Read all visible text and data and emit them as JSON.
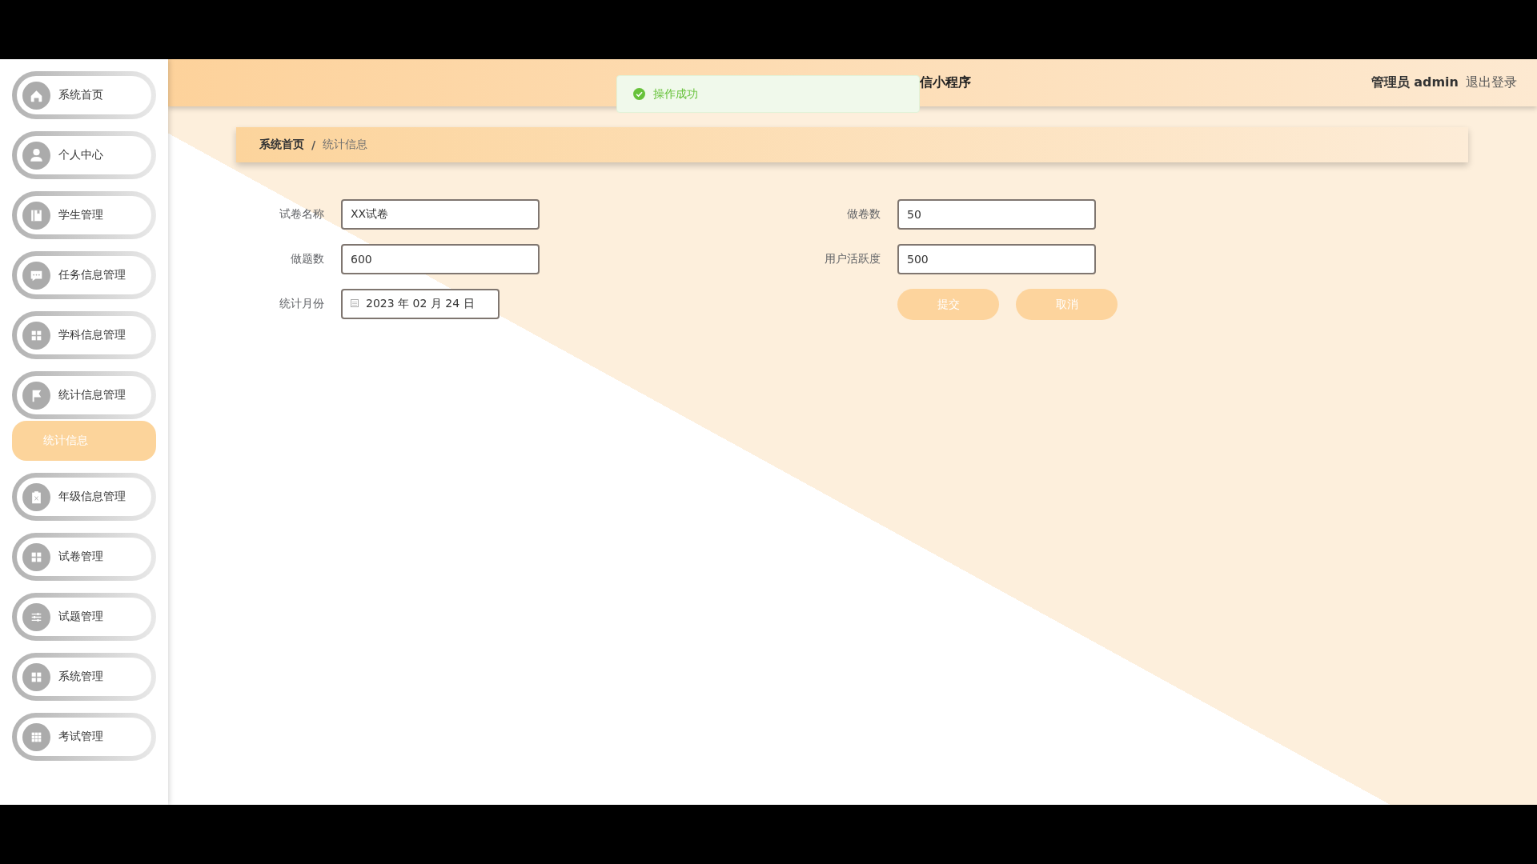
{
  "sidebar": {
    "items": [
      {
        "label": "系统首页"
      },
      {
        "label": "个人中心"
      },
      {
        "label": "学生管理"
      },
      {
        "label": "任务信息管理"
      },
      {
        "label": "学科信息管理"
      },
      {
        "label": "统计信息管理",
        "children": [
          {
            "label": "统计信息",
            "selected": true
          }
        ]
      },
      {
        "label": "年级信息管理"
      },
      {
        "label": "试卷管理"
      },
      {
        "label": "试题管理"
      },
      {
        "label": "系统管理"
      },
      {
        "label": "考试管理"
      }
    ]
  },
  "header": {
    "title": "信小程序",
    "user": "管理员 admin",
    "logout": "退出登录"
  },
  "toast": {
    "kind": "success",
    "message": "操作成功"
  },
  "breadcrumb": {
    "items": [
      "系统首页",
      "统计信息"
    ],
    "separator": "/"
  },
  "form": {
    "fields": [
      {
        "kind": "text",
        "label": "试卷名称",
        "value": "XX试卷"
      },
      {
        "kind": "text",
        "label": "做卷数",
        "value": "50"
      },
      {
        "kind": "text",
        "label": "做题数",
        "value": "600"
      },
      {
        "kind": "text",
        "label": "用户活跃度",
        "value": "500"
      },
      {
        "kind": "date",
        "label": "统计月份",
        "value": "2023 年 02 月 24 日"
      }
    ],
    "buttons": [
      "提交",
      "取消"
    ]
  }
}
